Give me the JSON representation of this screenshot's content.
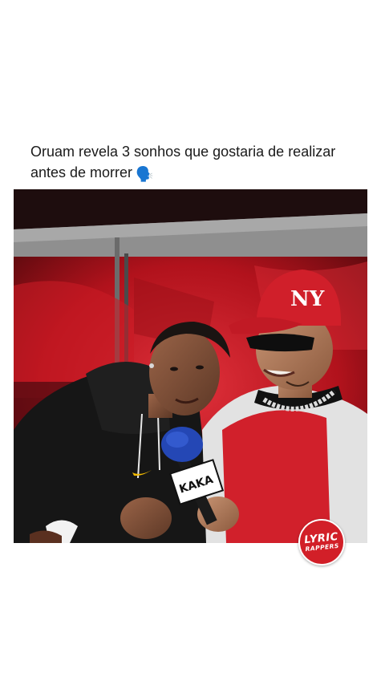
{
  "post": {
    "caption_line1": "Oruam revela 3 sonhos que gostaria de realizar",
    "caption_line2": "antes de morrer",
    "caption_emoji": "🗣️"
  },
  "video": {
    "description_icon": "video-frame",
    "mic_flag_text": "KAKA",
    "cap_logo": "NY"
  },
  "watermark": {
    "line1": "LYRIC",
    "line2": "RAPPERS",
    "color": "#d21f28"
  }
}
